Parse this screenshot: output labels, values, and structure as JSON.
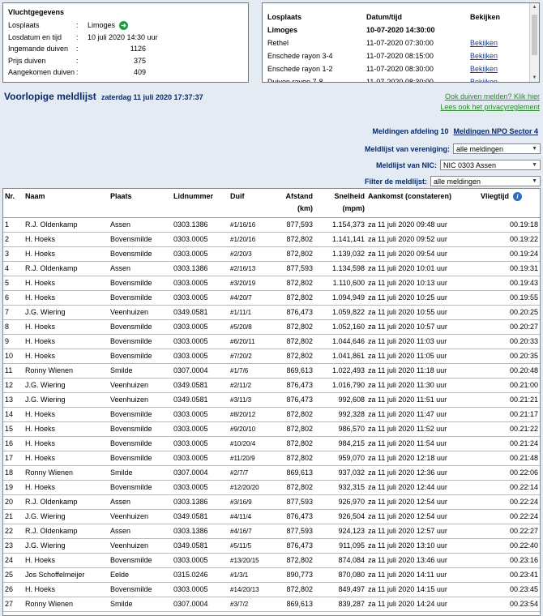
{
  "flight_info": {
    "title": "Vluchtgegevens",
    "rows": [
      {
        "label": "Losplaats",
        "value": "Limoges"
      },
      {
        "label": "Losdatum en tijd",
        "value": "10 juli 2020 14:30 uur"
      },
      {
        "label": "Ingemande duiven",
        "value": "1126"
      },
      {
        "label": "Prijs duiven",
        "value": "375"
      },
      {
        "label": "Aangekomen duiven",
        "value": "409"
      }
    ],
    "separator": ":"
  },
  "flights_panel": {
    "headers": [
      "Losplaats",
      "Datum/tijd",
      "Bekijken"
    ],
    "rows": [
      {
        "place": "Limoges",
        "datetime": "10-07-2020 14:30:00",
        "link": ""
      },
      {
        "place": "Rethel",
        "datetime": "11-07-2020 07:30:00",
        "link": "Bekijken"
      },
      {
        "place": "Enschede rayon 3-4",
        "datetime": "11-07-2020 08:15:00",
        "link": "Bekijken"
      },
      {
        "place": "Enschede rayon 1-2",
        "datetime": "11-07-2020 08:30:00",
        "link": "Bekijken"
      },
      {
        "place": "Duiven rayon 7-8",
        "datetime": "11-07-2020 08:30:00",
        "link": "Bekijken"
      }
    ]
  },
  "page": {
    "title": "Voorlopige meldlijst",
    "date": "zaterdag 11 juli 2020 17:37:37",
    "link_melden": "Ook duiven melden? Klik hier",
    "link_privacy": "Lees ook het privacyreglement",
    "section_label": "Meldingen afdeling 10",
    "section_link": "Meldingen NPO Sector 4"
  },
  "filters": {
    "vereniging_label": "Meldlijst van vereniging:",
    "vereniging_value": "alle meldingen",
    "nic_label": "Meldlijst van NIC:",
    "nic_value": "NIC 0303 Assen",
    "filter_label": "Filter de meldlijst:",
    "filter_value": "alle meldingen"
  },
  "table": {
    "headers": {
      "nr": "Nr.",
      "naam": "Naam",
      "plaats": "Plaats",
      "lidnummer": "Lidnummer",
      "duif": "Duif",
      "afstand": "Afstand",
      "afstand_unit": "(km)",
      "snelheid": "Snelheid",
      "snelheid_unit": "(mpm)",
      "aankomst": "Aankomst (constateren)",
      "vliegtijd": "Vliegtijd"
    },
    "rows": [
      [
        "1",
        "R.J. Oldenkamp",
        "Assen",
        "0303.1386",
        "#1/16/16",
        "877,593",
        "1.154,373",
        "za 11 juli 2020 09:48 uur",
        "00.19:18"
      ],
      [
        "2",
        "H. Hoeks",
        "Bovensmilde",
        "0303.0005",
        "#1/20/16",
        "872,802",
        "1.141,141",
        "za 11 juli 2020 09:52 uur",
        "00.19:22"
      ],
      [
        "3",
        "H. Hoeks",
        "Bovensmilde",
        "0303.0005",
        "#2/20/3",
        "872,802",
        "1.139,032",
        "za 11 juli 2020 09:54 uur",
        "00.19:24"
      ],
      [
        "4",
        "R.J. Oldenkamp",
        "Assen",
        "0303.1386",
        "#2/16/13",
        "877,593",
        "1.134,598",
        "za 11 juli 2020 10:01 uur",
        "00.19:31"
      ],
      [
        "5",
        "H. Hoeks",
        "Bovensmilde",
        "0303.0005",
        "#3/20/19",
        "872,802",
        "1.110,600",
        "za 11 juli 2020 10:13 uur",
        "00.19:43"
      ],
      [
        "6",
        "H. Hoeks",
        "Bovensmilde",
        "0303.0005",
        "#4/20/7",
        "872,802",
        "1.094,949",
        "za 11 juli 2020 10:25 uur",
        "00.19:55"
      ],
      [
        "7",
        "J.G. Wiering",
        "Veenhuizen",
        "0349.0581",
        "#1/11/1",
        "876,473",
        "1.059,822",
        "za 11 juli 2020 10:55 uur",
        "00.20:25"
      ],
      [
        "8",
        "H. Hoeks",
        "Bovensmilde",
        "0303.0005",
        "#5/20/8",
        "872,802",
        "1.052,160",
        "za 11 juli 2020 10:57 uur",
        "00.20:27"
      ],
      [
        "9",
        "H. Hoeks",
        "Bovensmilde",
        "0303.0005",
        "#6/20/11",
        "872,802",
        "1.044,646",
        "za 11 juli 2020 11:03 uur",
        "00.20:33"
      ],
      [
        "10",
        "H. Hoeks",
        "Bovensmilde",
        "0303.0005",
        "#7/20/2",
        "872,802",
        "1.041,861",
        "za 11 juli 2020 11:05 uur",
        "00.20:35"
      ],
      [
        "11",
        "Ronny Wienen",
        "Smilde",
        "0307.0004",
        "#1/7/6",
        "869,613",
        "1.022,493",
        "za 11 juli 2020 11:18 uur",
        "00.20:48"
      ],
      [
        "12",
        "J.G. Wiering",
        "Veenhuizen",
        "0349.0581",
        "#2/11/2",
        "876,473",
        "1.016,790",
        "za 11 juli 2020 11:30 uur",
        "00.21:00"
      ],
      [
        "13",
        "J.G. Wiering",
        "Veenhuizen",
        "0349.0581",
        "#3/11/3",
        "876,473",
        "992,608",
        "za 11 juli 2020 11:51 uur",
        "00.21:21"
      ],
      [
        "14",
        "H. Hoeks",
        "Bovensmilde",
        "0303.0005",
        "#8/20/12",
        "872,802",
        "992,328",
        "za 11 juli 2020 11:47 uur",
        "00.21:17"
      ],
      [
        "15",
        "H. Hoeks",
        "Bovensmilde",
        "0303.0005",
        "#9/20/10",
        "872,802",
        "986,570",
        "za 11 juli 2020 11:52 uur",
        "00.21:22"
      ],
      [
        "16",
        "H. Hoeks",
        "Bovensmilde",
        "0303.0005",
        "#10/20/4",
        "872,802",
        "984,215",
        "za 11 juli 2020 11:54 uur",
        "00.21:24"
      ],
      [
        "17",
        "H. Hoeks",
        "Bovensmilde",
        "0303.0005",
        "#11/20/9",
        "872,802",
        "959,070",
        "za 11 juli 2020 12:18 uur",
        "00.21:48"
      ],
      [
        "18",
        "Ronny Wienen",
        "Smilde",
        "0307.0004",
        "#2/7/7",
        "869,613",
        "937,032",
        "za 11 juli 2020 12:36 uur",
        "00.22:06"
      ],
      [
        "19",
        "H. Hoeks",
        "Bovensmilde",
        "0303.0005",
        "#12/20/20",
        "872,802",
        "932,315",
        "za 11 juli 2020 12:44 uur",
        "00.22:14"
      ],
      [
        "20",
        "R.J. Oldenkamp",
        "Assen",
        "0303.1386",
        "#3/16/9",
        "877,593",
        "926,970",
        "za 11 juli 2020 12:54 uur",
        "00.22:24"
      ],
      [
        "21",
        "J.G. Wiering",
        "Veenhuizen",
        "0349.0581",
        "#4/11/4",
        "876,473",
        "926,504",
        "za 11 juli 2020 12:54 uur",
        "00.22:24"
      ],
      [
        "22",
        "R.J. Oldenkamp",
        "Assen",
        "0303.1386",
        "#4/16/7",
        "877,593",
        "924,123",
        "za 11 juli 2020 12:57 uur",
        "00.22:27"
      ],
      [
        "23",
        "J.G. Wiering",
        "Veenhuizen",
        "0349.0581",
        "#5/11/5",
        "876,473",
        "911,095",
        "za 11 juli 2020 13:10 uur",
        "00.22:40"
      ],
      [
        "24",
        "H. Hoeks",
        "Bovensmilde",
        "0303.0005",
        "#13/20/15",
        "872,802",
        "874,084",
        "za 11 juli 2020 13:46 uur",
        "00.23:16"
      ],
      [
        "25",
        "Jos Schoffelmeijer",
        "Eelde",
        "0315.0246",
        "#1/3/1",
        "890,773",
        "870,080",
        "za 11 juli 2020 14:11 uur",
        "00.23:41"
      ],
      [
        "26",
        "H. Hoeks",
        "Bovensmilde",
        "0303.0005",
        "#14/20/13",
        "872,802",
        "849,497",
        "za 11 juli 2020 14:15 uur",
        "00.23:45"
      ],
      [
        "27",
        "Ronny Wienen",
        "Smilde",
        "0307.0004",
        "#3/7/2",
        "869,613",
        "839,287",
        "za 11 juli 2020 14:24 uur",
        "00.23:54"
      ]
    ]
  }
}
